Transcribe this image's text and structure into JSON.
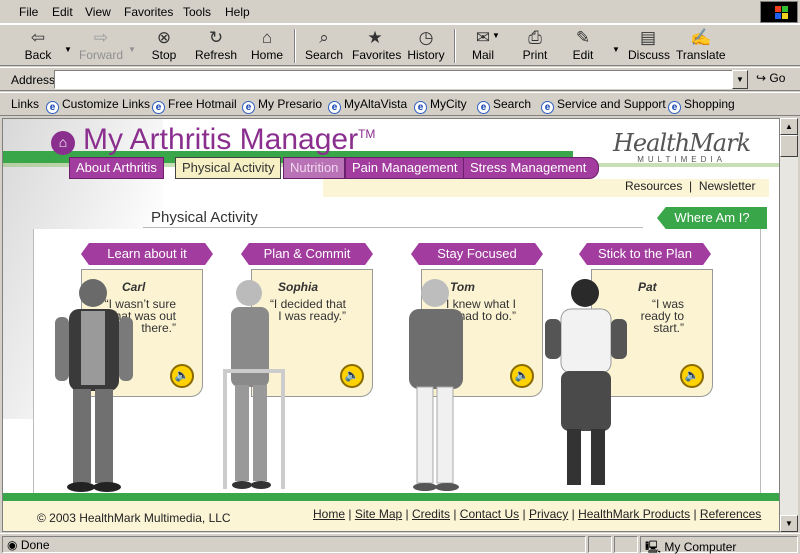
{
  "menu": [
    "File",
    "Edit",
    "View",
    "Favorites",
    "Tools",
    "Help"
  ],
  "toolbar": {
    "back": "Back",
    "forward": "Forward",
    "stop": "Stop",
    "refresh": "Refresh",
    "home": "Home",
    "search": "Search",
    "favorites": "Favorites",
    "history": "History",
    "mail": "Mail",
    "print": "Print",
    "edit": "Edit",
    "discuss": "Discuss",
    "translate": "Translate"
  },
  "address": {
    "label": "Address",
    "value": "",
    "go": "Go"
  },
  "links": {
    "label": "Links",
    "items": [
      "Customize Links",
      "Free Hotmail",
      "My Presario",
      "MyAltaVista",
      "MyCity",
      "Search",
      "Service and Support",
      "Shopping"
    ]
  },
  "site": {
    "title": "My Arthritis Manager",
    "tm": "TM",
    "logo_main": "HealthMark",
    "logo_sub": "MULTIMEDIA",
    "nav": [
      "About Arthritis",
      "Physical Activity",
      "Nutrition",
      "Pain Management",
      "Stress Management"
    ],
    "resources": "Resources",
    "newsletter": "Newsletter",
    "section": "Physical Activity",
    "whereami": "Where Am I?",
    "steps": [
      {
        "tab": "Learn about it",
        "name": "Carl",
        "quote": "“I wasn’t sure what was out there.”"
      },
      {
        "tab": "Plan & Commit",
        "name": "Sophia",
        "quote": "“I decided that I was ready.”"
      },
      {
        "tab": "Stay Focused",
        "name": "Tom",
        "quote": "“I knew what I had to do.”"
      },
      {
        "tab": "Stick to the Plan",
        "name": "Pat",
        "quote": "“I was ready to start.”"
      }
    ],
    "copyright": "© 2003 HealthMark Multimedia, LLC",
    "footer_links": [
      "Home",
      "Site Map",
      "Credits",
      "Contact Us",
      "Privacy",
      "HealthMark Products",
      "References"
    ]
  },
  "status": {
    "text": "Done",
    "zone": "My Computer"
  },
  "colors": {
    "brand_purple": "#8b2f8f",
    "nav_green": "#3aa64a",
    "card_bg": "#fbf3d2"
  }
}
